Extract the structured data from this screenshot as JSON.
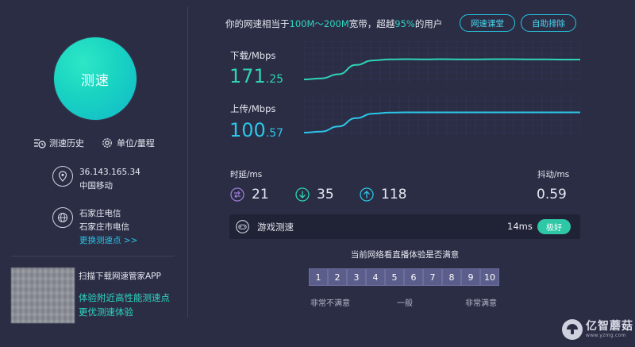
{
  "colors": {
    "background": "#2b2d45",
    "accent_teal": "#2dd6c0",
    "accent_cyan": "#27c6e8",
    "download_line": "#2fd3b6",
    "upload_line": "#2bc6e8",
    "rating_box": "#5b5e8a",
    "badge": "#2ec8a6"
  },
  "sidebar": {
    "speed_button_label": "测速",
    "history_label": "测速历史",
    "unit_label": "单位/量程",
    "ip_address": "36.143.165.34",
    "isp": "中国移动",
    "server_line1": "石家庄电信",
    "server_line2": "石家庄市电信",
    "change_server_link": "更换测速点 >>",
    "app_title": "扫描下载网速管家APP",
    "app_line1": "体验附近高性能测速点",
    "app_line2": "更优测速体验"
  },
  "header": {
    "summary_prefix": "你的网速相当于",
    "bandwidth_range": "100M～200M",
    "summary_middle": "宽带，超越",
    "beat_percent": "95%",
    "summary_suffix": "的用户",
    "classroom_button": "网速课堂",
    "troubleshoot_button": "自助排除"
  },
  "download": {
    "label": "下载/Mbps",
    "value_int": "171",
    "value_dec": ".25",
    "curve": [
      0,
      0.05,
      0.25,
      0.7,
      0.92,
      0.97,
      0.98,
      0.97,
      0.98,
      0.97,
      0.97,
      0.98,
      0.98,
      0.97,
      0.97,
      0.96,
      0.96
    ]
  },
  "upload": {
    "label": "上传/Mbps",
    "value_int": "100",
    "value_dec": ".57",
    "curve": [
      0,
      0.05,
      0.3,
      0.7,
      0.92,
      0.97,
      0.98,
      0.98,
      0.98,
      0.98,
      0.98,
      0.98,
      0.98,
      0.98,
      0.98,
      0.98,
      0.98
    ]
  },
  "latency": {
    "label": "时延/ms",
    "avg": "21",
    "min": "35",
    "max": "118",
    "jitter_label": "抖动/ms",
    "jitter": "0.59"
  },
  "game": {
    "label": "游戏测速",
    "ms": "14ms",
    "rating": "极好"
  },
  "survey": {
    "question": "当前网络看直播体验是否满意",
    "scores": [
      "1",
      "2",
      "3",
      "4",
      "5",
      "6",
      "7",
      "8",
      "9",
      "10"
    ],
    "low_label": "非常不满意",
    "mid_label": "一般",
    "high_label": "非常满意"
  },
  "watermark": {
    "brand": "亿智蘑菇",
    "url": "www.yzmg.com"
  }
}
